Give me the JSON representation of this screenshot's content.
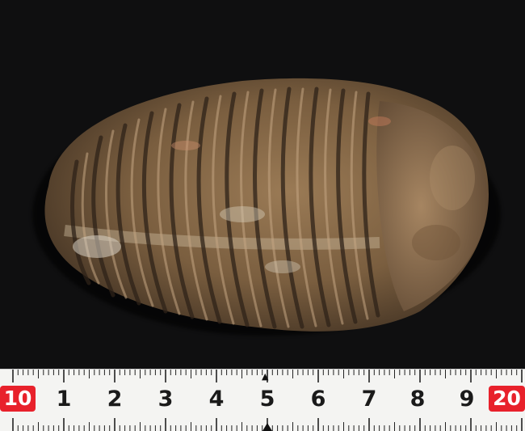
{
  "ruler": {
    "left_marker": "10",
    "right_marker": "20",
    "numbers": [
      "1",
      "2",
      "3",
      "4",
      "5",
      "6",
      "7",
      "8",
      "9"
    ],
    "accent_color": "#e8212b",
    "center_pointer": "▲"
  }
}
